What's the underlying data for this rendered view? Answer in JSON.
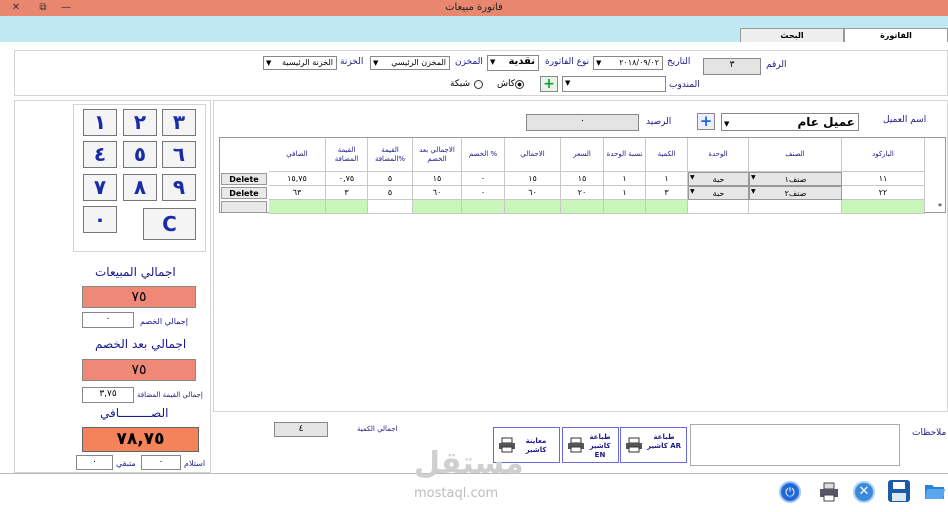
{
  "window": {
    "title": "فاتورة مبيعات",
    "close_icon": "✕",
    "restore_icon": "⧉",
    "minimize_icon": "—"
  },
  "tabs": [
    {
      "label": "الفاتورة"
    },
    {
      "label": "البحث"
    }
  ],
  "header": {
    "number_label": "الرقم",
    "number_value": "٣",
    "date_label": "التاريخ",
    "date_value": "٢٠١٨/٠٩/٠٢",
    "invoice_type_label": "نوع الفاتورة",
    "invoice_type_value": "نقدية",
    "store_label": "المخزن",
    "store_value": "المخزن الرئيسي",
    "treasury_label": "الخزنة",
    "treasury_value": "الخزنة الرئيسية",
    "rep_label": "المندوب",
    "rep_value": "",
    "cash_label": "كاش",
    "network_label": "شبكة",
    "customer_label": "اسم العميل",
    "customer_value": "عميل عام",
    "balance_label": "الرصيد",
    "balance_value": "٠"
  },
  "keypad": [
    "٣",
    "٢",
    "١",
    "٦",
    "٥",
    "٤",
    "٩",
    "٨",
    "٧",
    "C",
    "٠"
  ],
  "totals": {
    "sales_label": "اجمالي المبيعات",
    "sales_value": "٧٥",
    "discount_label": "إجمالي الخصم",
    "discount_value": "٠",
    "after_discount_label": "اجمالي بعد الخصم",
    "after_discount_value": "٧٥",
    "vat_label": "إجمالي القيمة المضافة",
    "vat_value": "٣,٧٥",
    "net_label": "الصـــــــــافي",
    "net_value": "٧٨,٧٥",
    "received_label": "استلام",
    "received_value": "٠",
    "remaining_label": "متبقي",
    "remaining_value": "٠",
    "qty_total_label": "اجمالي الكمية",
    "qty_total_value": "٤",
    "notes_label": "ملاحظات"
  },
  "table": {
    "headers": [
      "الباركود",
      "الصنف",
      "الوحدة",
      "الكمية",
      "نسبة الوحدة",
      "السعر",
      "الاجمالي",
      "الخصم %",
      "الاجمالي بعد الخصم",
      "القيمة المضافة%",
      "القيمة المضافة",
      "الصافي"
    ],
    "rows": [
      {
        "barcode": "١١",
        "item": "صنف١",
        "unit": "حبة",
        "qty": "١",
        "ratio": "١",
        "price": "١٥",
        "total": "١٥",
        "disc": "٠",
        "after": "١٥",
        "vatp": "٥",
        "vat": "٠,٧٥",
        "net": "١٥,٧٥",
        "del": "Delete"
      },
      {
        "barcode": "٢٢",
        "item": "صنف٢",
        "unit": "حبة",
        "qty": "٣",
        "ratio": "١",
        "price": "٢٠",
        "total": "٦٠",
        "disc": "٠",
        "after": "٦٠",
        "vatp": "٥",
        "vat": "٣",
        "net": "٦٣",
        "del": "Delete"
      }
    ]
  },
  "print_buttons": [
    {
      "label": "طباعة كاشير AR"
    },
    {
      "label": "طباعة كاشير EN"
    },
    {
      "label": "معاينة كاشير"
    }
  ],
  "watermark": {
    "ar": "مستقل",
    "en": "mostaql.com"
  }
}
